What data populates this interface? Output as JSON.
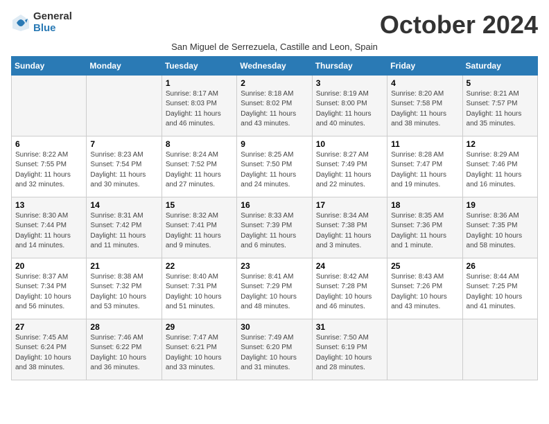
{
  "logo": {
    "general": "General",
    "blue": "Blue"
  },
  "header": {
    "title": "October 2024",
    "subtitle": "San Miguel de Serrezuela, Castille and Leon, Spain"
  },
  "weekdays": [
    "Sunday",
    "Monday",
    "Tuesday",
    "Wednesday",
    "Thursday",
    "Friday",
    "Saturday"
  ],
  "weeks": [
    [
      {
        "day": "",
        "detail": ""
      },
      {
        "day": "",
        "detail": ""
      },
      {
        "day": "1",
        "detail": "Sunrise: 8:17 AM\nSunset: 8:03 PM\nDaylight: 11 hours\nand 46 minutes."
      },
      {
        "day": "2",
        "detail": "Sunrise: 8:18 AM\nSunset: 8:02 PM\nDaylight: 11 hours\nand 43 minutes."
      },
      {
        "day": "3",
        "detail": "Sunrise: 8:19 AM\nSunset: 8:00 PM\nDaylight: 11 hours\nand 40 minutes."
      },
      {
        "day": "4",
        "detail": "Sunrise: 8:20 AM\nSunset: 7:58 PM\nDaylight: 11 hours\nand 38 minutes."
      },
      {
        "day": "5",
        "detail": "Sunrise: 8:21 AM\nSunset: 7:57 PM\nDaylight: 11 hours\nand 35 minutes."
      }
    ],
    [
      {
        "day": "6",
        "detail": "Sunrise: 8:22 AM\nSunset: 7:55 PM\nDaylight: 11 hours\nand 32 minutes."
      },
      {
        "day": "7",
        "detail": "Sunrise: 8:23 AM\nSunset: 7:54 PM\nDaylight: 11 hours\nand 30 minutes."
      },
      {
        "day": "8",
        "detail": "Sunrise: 8:24 AM\nSunset: 7:52 PM\nDaylight: 11 hours\nand 27 minutes."
      },
      {
        "day": "9",
        "detail": "Sunrise: 8:25 AM\nSunset: 7:50 PM\nDaylight: 11 hours\nand 24 minutes."
      },
      {
        "day": "10",
        "detail": "Sunrise: 8:27 AM\nSunset: 7:49 PM\nDaylight: 11 hours\nand 22 minutes."
      },
      {
        "day": "11",
        "detail": "Sunrise: 8:28 AM\nSunset: 7:47 PM\nDaylight: 11 hours\nand 19 minutes."
      },
      {
        "day": "12",
        "detail": "Sunrise: 8:29 AM\nSunset: 7:46 PM\nDaylight: 11 hours\nand 16 minutes."
      }
    ],
    [
      {
        "day": "13",
        "detail": "Sunrise: 8:30 AM\nSunset: 7:44 PM\nDaylight: 11 hours\nand 14 minutes."
      },
      {
        "day": "14",
        "detail": "Sunrise: 8:31 AM\nSunset: 7:42 PM\nDaylight: 11 hours\nand 11 minutes."
      },
      {
        "day": "15",
        "detail": "Sunrise: 8:32 AM\nSunset: 7:41 PM\nDaylight: 11 hours\nand 9 minutes."
      },
      {
        "day": "16",
        "detail": "Sunrise: 8:33 AM\nSunset: 7:39 PM\nDaylight: 11 hours\nand 6 minutes."
      },
      {
        "day": "17",
        "detail": "Sunrise: 8:34 AM\nSunset: 7:38 PM\nDaylight: 11 hours\nand 3 minutes."
      },
      {
        "day": "18",
        "detail": "Sunrise: 8:35 AM\nSunset: 7:36 PM\nDaylight: 11 hours\nand 1 minute."
      },
      {
        "day": "19",
        "detail": "Sunrise: 8:36 AM\nSunset: 7:35 PM\nDaylight: 10 hours\nand 58 minutes."
      }
    ],
    [
      {
        "day": "20",
        "detail": "Sunrise: 8:37 AM\nSunset: 7:34 PM\nDaylight: 10 hours\nand 56 minutes."
      },
      {
        "day": "21",
        "detail": "Sunrise: 8:38 AM\nSunset: 7:32 PM\nDaylight: 10 hours\nand 53 minutes."
      },
      {
        "day": "22",
        "detail": "Sunrise: 8:40 AM\nSunset: 7:31 PM\nDaylight: 10 hours\nand 51 minutes."
      },
      {
        "day": "23",
        "detail": "Sunrise: 8:41 AM\nSunset: 7:29 PM\nDaylight: 10 hours\nand 48 minutes."
      },
      {
        "day": "24",
        "detail": "Sunrise: 8:42 AM\nSunset: 7:28 PM\nDaylight: 10 hours\nand 46 minutes."
      },
      {
        "day": "25",
        "detail": "Sunrise: 8:43 AM\nSunset: 7:26 PM\nDaylight: 10 hours\nand 43 minutes."
      },
      {
        "day": "26",
        "detail": "Sunrise: 8:44 AM\nSunset: 7:25 PM\nDaylight: 10 hours\nand 41 minutes."
      }
    ],
    [
      {
        "day": "27",
        "detail": "Sunrise: 7:45 AM\nSunset: 6:24 PM\nDaylight: 10 hours\nand 38 minutes."
      },
      {
        "day": "28",
        "detail": "Sunrise: 7:46 AM\nSunset: 6:22 PM\nDaylight: 10 hours\nand 36 minutes."
      },
      {
        "day": "29",
        "detail": "Sunrise: 7:47 AM\nSunset: 6:21 PM\nDaylight: 10 hours\nand 33 minutes."
      },
      {
        "day": "30",
        "detail": "Sunrise: 7:49 AM\nSunset: 6:20 PM\nDaylight: 10 hours\nand 31 minutes."
      },
      {
        "day": "31",
        "detail": "Sunrise: 7:50 AM\nSunset: 6:19 PM\nDaylight: 10 hours\nand 28 minutes."
      },
      {
        "day": "",
        "detail": ""
      },
      {
        "day": "",
        "detail": ""
      }
    ]
  ]
}
